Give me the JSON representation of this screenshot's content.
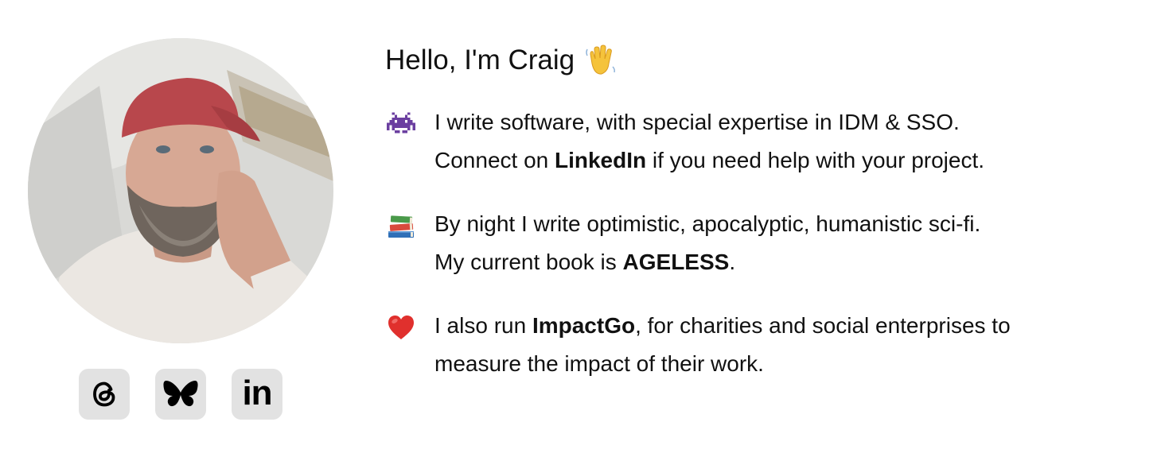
{
  "greeting": "Hello, I'm Craig",
  "wave_emoji": "wave-icon",
  "items": [
    {
      "icon": "alien-monster-icon",
      "line1": "I write software, with special expertise in IDM & SSO.",
      "line2_pre": "Connect on ",
      "line2_link": "LinkedIn",
      "line2_post": " if you need help with your project."
    },
    {
      "icon": "books-icon",
      "line1": "By night I write optimistic, apocalyptic, humanistic sci-fi.",
      "line2_pre": "My current book is ",
      "line2_link": "AGELESS",
      "line2_post": "."
    },
    {
      "icon": "red-heart-icon",
      "line1_pre": "I also run ",
      "line1_link": "ImpactGo",
      "line1_post": ", for charities and social enterprises to",
      "line2": "measure the impact of their work."
    }
  ],
  "socials": {
    "linkedin_text": "in",
    "icons": [
      "threads-icon",
      "bluesky-butterfly-icon",
      "linkedin-icon"
    ]
  },
  "colors": {
    "social_bg": "#e2e2e2",
    "text": "#111111"
  }
}
